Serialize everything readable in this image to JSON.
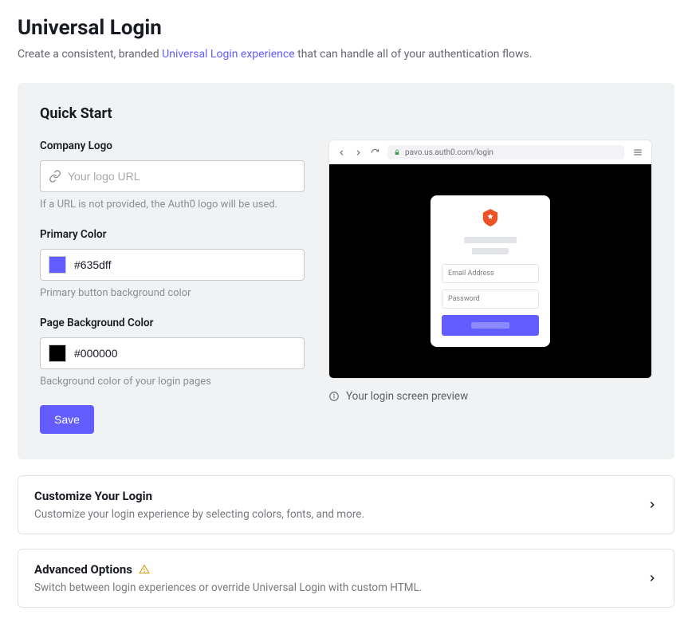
{
  "page": {
    "title": "Universal Login",
    "sub_pre": "Create a consistent, branded ",
    "sub_link": "Universal Login experience",
    "sub_post": " that can handle all of your authentication flows."
  },
  "quickstart": {
    "heading": "Quick Start",
    "logo": {
      "label": "Company Logo",
      "placeholder": "Your logo URL",
      "help": "If a URL is not provided, the Auth0 logo will be used."
    },
    "primary": {
      "label": "Primary Color",
      "value": "#635dff",
      "help": "Primary button background color"
    },
    "background": {
      "label": "Page Background Color",
      "value": "#000000",
      "help": "Background color of your login pages"
    },
    "save_label": "Save"
  },
  "preview": {
    "url": "pavo.us.auth0.com/login",
    "email_ph": "Email Address",
    "pw_ph": "Password",
    "caption": "Your login screen preview"
  },
  "rows": {
    "customize": {
      "title": "Customize Your Login",
      "desc": "Customize your login experience by selecting colors, fonts, and more."
    },
    "advanced": {
      "title": "Advanced Options",
      "desc": "Switch between login experiences or override Universal Login with custom HTML."
    }
  },
  "colors": {
    "primary": "#635dff",
    "bg": "#000000",
    "auth0_orange": "#eb5424"
  }
}
